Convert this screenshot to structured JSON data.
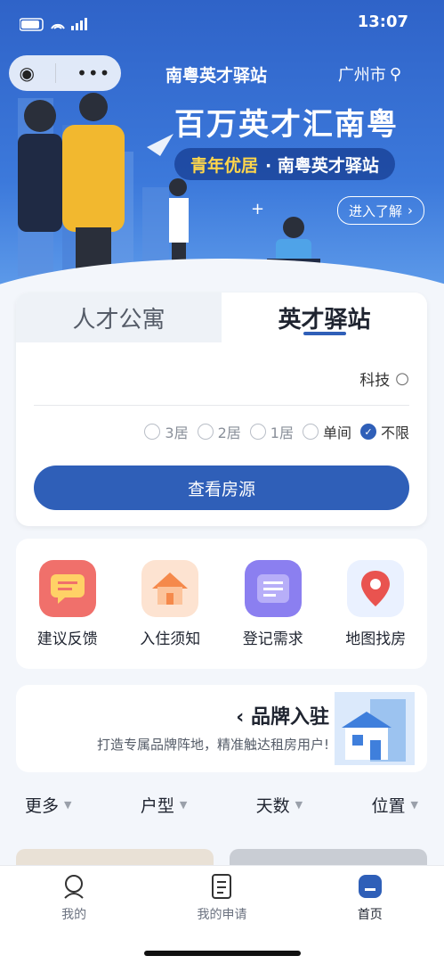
{
  "status_bar": {
    "time": "13:07"
  },
  "header": {
    "location": "广州市",
    "station_title": "南粤英才驿站",
    "headline": "百万英才汇南粤",
    "tagline_highlight": "青年优居",
    "tagline_rest": "· 南粤英才驿站",
    "more_button": "进入了解"
  },
  "tabs": [
    {
      "label": "人才公寓",
      "active": false
    },
    {
      "label": "英才驿站",
      "active": true
    }
  ],
  "search": {
    "placeholder": "科技"
  },
  "room_filters": [
    {
      "label": "不限",
      "selected": true
    },
    {
      "label": "单间",
      "selected": false
    },
    {
      "label": "1居",
      "selected": false
    },
    {
      "label": "2居",
      "selected": false
    },
    {
      "label": "3居",
      "selected": false
    }
  ],
  "view_button": "查看房源",
  "features": [
    {
      "label": "地图找房",
      "icon": "map-pin-icon",
      "color": "#e9534f"
    },
    {
      "label": "登记需求",
      "icon": "register-form-icon",
      "color": "#8b7ff0"
    },
    {
      "label": "入住须知",
      "icon": "house-icon",
      "color": "#f5894b"
    },
    {
      "label": "建议反馈",
      "icon": "feedback-message-icon",
      "color": "#f0706b"
    }
  ],
  "brand": {
    "title": "品牌入驻",
    "subtitle": "打造专属品牌阵地，精准触达租房用户!"
  },
  "list_filters": [
    {
      "label": "位置"
    },
    {
      "label": "天数"
    },
    {
      "label": "户型"
    },
    {
      "label": "更多"
    }
  ],
  "bottom_nav": [
    {
      "label": "首页",
      "icon": "home-icon",
      "active": true
    },
    {
      "label": "我的申请",
      "icon": "document-icon",
      "active": false
    },
    {
      "label": "我的",
      "icon": "user-icon",
      "active": false
    }
  ],
  "colors": {
    "primary": "#2f5fb8",
    "hero_top": "#2f63c8",
    "accent_yellow": "#ffd64a"
  }
}
